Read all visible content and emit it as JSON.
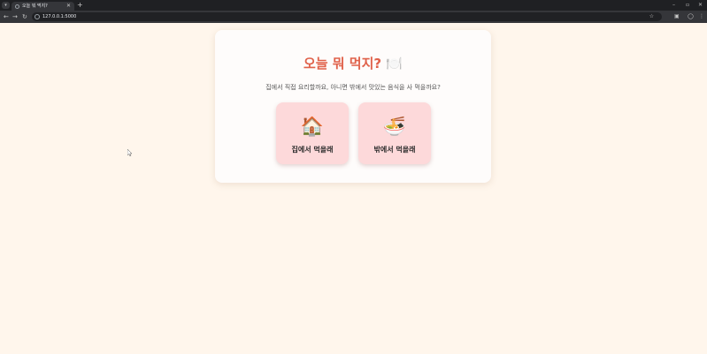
{
  "browser": {
    "tab_title": "오늘 뭐 먹지?",
    "url": "127.0.0.1:5000",
    "icons": [
      "tab-menu-icon",
      "favicon-icon",
      "close-icon",
      "new-tab-icon",
      "minimize-icon",
      "maximize-icon",
      "window-close-icon",
      "back-icon",
      "forward-icon",
      "reload-icon",
      "site-info-icon",
      "star-icon",
      "extensions-icon",
      "profile-icon",
      "menu-icon"
    ]
  },
  "page": {
    "title": "오늘 뭐 먹지?",
    "title_emoji": "🍽️",
    "subtitle": "집에서 직접 요리할까요, 아니면 밖에서 맛있는 음식을 사 먹을까요?",
    "choices": [
      {
        "emoji": "🏠",
        "label": "집에서 먹을래"
      },
      {
        "emoji": "🍜",
        "label": "밖에서 먹을래"
      }
    ]
  },
  "colors": {
    "background": "#fff6ec",
    "card": "#fefcfb",
    "title": "#e0614a",
    "choice_bg": "#fdd9da"
  }
}
